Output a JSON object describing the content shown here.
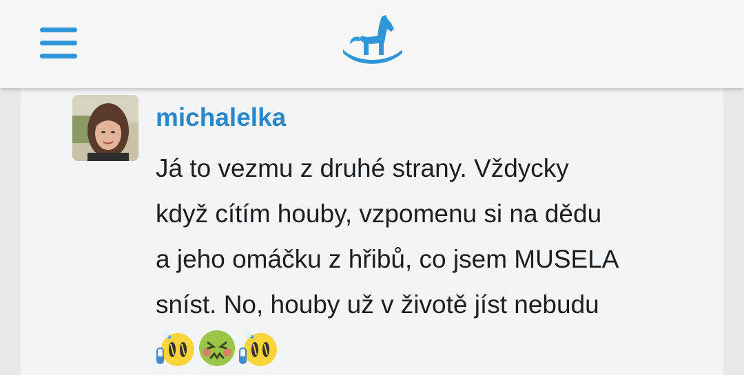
{
  "header": {
    "menu_icon": "hamburger-menu-icon",
    "logo_icon": "rocking-horse-logo-icon",
    "accent_color": "#2f96d8"
  },
  "comment": {
    "author": "michalelka",
    "avatar_icon": "user-avatar-photo",
    "lines": [
      "Já to vezmu z druhé strany. Vždycky",
      "když cítím houby, vzpomenu si na dědu",
      "a jeho omáčku z hřibů, co jsem MUSELA",
      "sníst. No, houby už v životě jíst nebudu"
    ],
    "emojis": [
      "crying-baby-bottle-emoji",
      "nauseated-face-emoji",
      "crying-baby-bottle-emoji"
    ]
  }
}
